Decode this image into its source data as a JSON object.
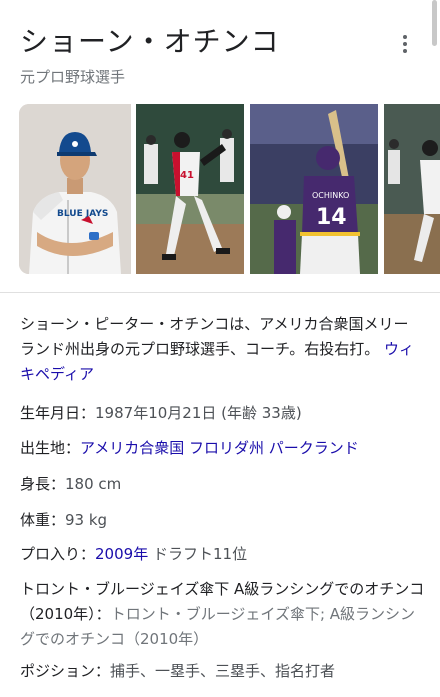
{
  "header": {
    "title": "ショーン・オチンコ",
    "subtitle": "元プロ野球選手"
  },
  "gallery": {
    "photos": [
      {
        "icon": "player-portrait-image"
      },
      {
        "icon": "batting-swing-image"
      },
      {
        "icon": "batter-number-14-image",
        "jersey_name": "OCHINKO",
        "jersey_number": "14"
      },
      {
        "icon": "batting-action-image"
      }
    ]
  },
  "description": {
    "text": "ショーン・ピーター・オチンコは、アメリカ合衆国メリーランド州出身の元プロ野球選手、コーチ。右投右打。",
    "source_link": "ウィキペディア"
  },
  "facts": {
    "birth": {
      "label": "生年月日：",
      "value": "1987年10月21日 (年齢 33歳)"
    },
    "birthplace": {
      "label": "出生地：",
      "link": "アメリカ合衆国 フロリダ州 パークランド"
    },
    "height": {
      "label": "身長：",
      "value": "180 cm"
    },
    "weight": {
      "label": "体重：",
      "value": "93 kg"
    },
    "draft": {
      "label": "プロ入り：",
      "link": "2009年",
      "value": "ドラフト11位"
    },
    "team": {
      "label": "トロント・ブルージェイズ傘下 A級ランシングでのオチンコ（2010年）：",
      "value": "トロント・ブルージェイズ傘下; A級ランシングでのオチンコ（2010年）"
    },
    "position": {
      "label": "ポジション：",
      "value": "捕手、一塁手、三塁手、指名打者"
    }
  },
  "colors": {
    "link": "#1a0dab",
    "text": "#202124",
    "muted": "#70757a",
    "jays_blue": "#134a8e",
    "lsu_purple": "#46296e"
  },
  "menu": {
    "icon": "more-vert-icon"
  }
}
